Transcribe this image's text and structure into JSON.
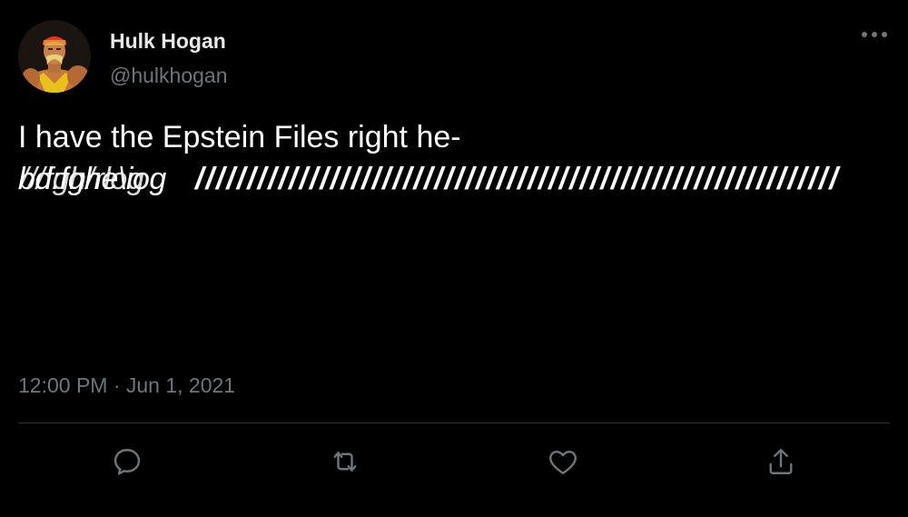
{
  "author": {
    "display_name": "Hulk Hogan",
    "handle": "@hulkhogan",
    "avatar_icon": "wrestler-avatar"
  },
  "tweet": {
    "line1": "I have the Epstein Files right he-",
    "line2_glitch": "bd:fghe\\iog",
    "line2_glitch_overlay": "///fgh/rlog",
    "line2_slashes": "//////////////////////////////////////////////////////////////"
  },
  "meta": {
    "timestamp": "12:00 PM · Jun 1, 2021"
  },
  "actions": {
    "more_icon": "more-dots-icon",
    "reply_icon": "reply-icon",
    "retweet_icon": "retweet-icon",
    "like_icon": "heart-icon",
    "share_icon": "share-icon"
  },
  "colors": {
    "background": "#000000",
    "primary_text": "#e7e9ea",
    "secondary_text": "#6e767d",
    "divider": "#2f3336"
  }
}
